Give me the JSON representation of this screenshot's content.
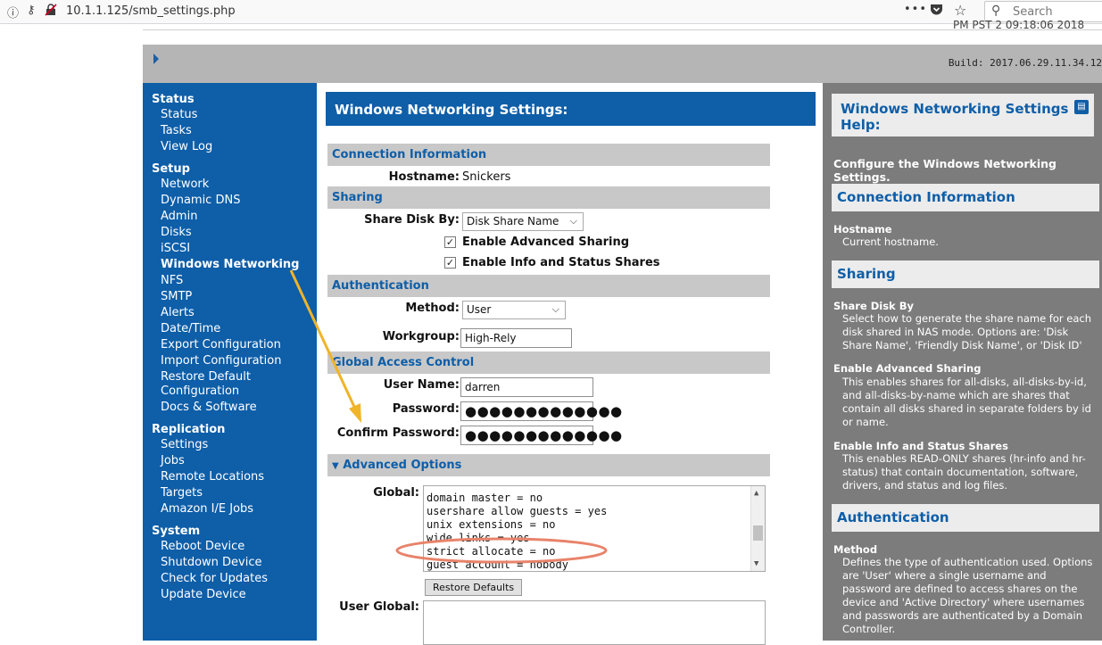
{
  "browser": {
    "url": "10.1.1.125/smb_settings.php",
    "search_placeholder": "Search",
    "menu_dots": "•••"
  },
  "header": {
    "cut_text": "PM PST 2 09:18:06 2018",
    "build": "Build: 2017.06.29.11.34.12"
  },
  "sidebar": {
    "sections": [
      {
        "title": "Status",
        "items": [
          "Status",
          "Tasks",
          "View Log"
        ]
      },
      {
        "title": "Setup",
        "items": [
          "Network",
          "Dynamic DNS",
          "Admin",
          "Disks",
          "iSCSI",
          "Windows Networking",
          "NFS",
          "SMTP",
          "Alerts",
          "Date/Time",
          "Export Configuration",
          "Import Configuration",
          "Restore Default",
          "Configuration",
          "Docs & Software"
        ]
      },
      {
        "title": "Replication",
        "items": [
          "Settings",
          "Jobs",
          "Remote Locations",
          "Targets",
          "Amazon I/E Jobs"
        ]
      },
      {
        "title": "System",
        "items": [
          "Reboot Device",
          "Shutdown Device",
          "Check for Updates",
          "Update Device"
        ]
      }
    ]
  },
  "main": {
    "title": "Windows Networking Settings:",
    "conn_section": "Connection Information",
    "hostname_label": "Hostname:",
    "hostname_value": "Snickers",
    "sharing_section": "Sharing",
    "share_disk_label": "Share Disk By:",
    "share_disk_value": "Disk Share Name",
    "adv_sharing_label": "Enable Advanced Sharing",
    "info_shares_label": "Enable Info and Status Shares",
    "auth_section": "Authentication",
    "method_label": "Method:",
    "method_value": "User",
    "workgroup_label": "Workgroup:",
    "workgroup_value": "High-Rely",
    "gac_section": "Global Access Control",
    "username_label": "User Name:",
    "username_value": "darren",
    "password_label": "Password:",
    "password_value": "●●●●●●●●●●●●●",
    "confirm_label": "Confirm Password:",
    "confirm_value": "●●●●●●●●●●●●●",
    "advanced_section": "Advanced Options",
    "global_label": "Global:",
    "global_lines": [
      "domain master = no",
      "usershare allow guests = yes",
      "unix extensions = no",
      "wide links = yes",
      "strict allocate = no",
      "guest account = nobody"
    ],
    "restore_button": "Restore Defaults",
    "user_global_label": "User Global:"
  },
  "help": {
    "title": "Windows Networking Settings Help:",
    "intro": "Configure the Windows Networking Settings.",
    "sec_conn": "Connection Information",
    "hostname_term": "Hostname",
    "hostname_desc": "Current hostname.",
    "sec_sharing": "Sharing",
    "share_term": "Share Disk By",
    "share_desc": "Select how to generate the share name for each disk shared in NAS mode. Options are: 'Disk Share Name', 'Friendly Disk Name', or 'Disk ID'",
    "adv_term": "Enable Advanced Sharing",
    "adv_desc": "This enables shares for all-disks, all-disks-by-id, and all-disks-by-name which are shares that contain all disks shared in separate folders by id or name.",
    "info_term": "Enable Info and Status Shares",
    "info_desc": "This enables READ-ONLY shares (hr-info and hr-status) that contain documentation, software, drivers, and status and log files.",
    "sec_auth": "Authentication",
    "method_term": "Method",
    "method_desc": "Defines the type of authentication used. Options are 'User' where a single username and password are defined to access shares on the device and 'Active Directory' where usernames and passwords are authenticated by a Domain Controller."
  },
  "colors": {
    "brand_blue": "#0e5ea8",
    "annotation_arrow": "#f0b429",
    "annotation_ellipse": "#e8836a"
  }
}
